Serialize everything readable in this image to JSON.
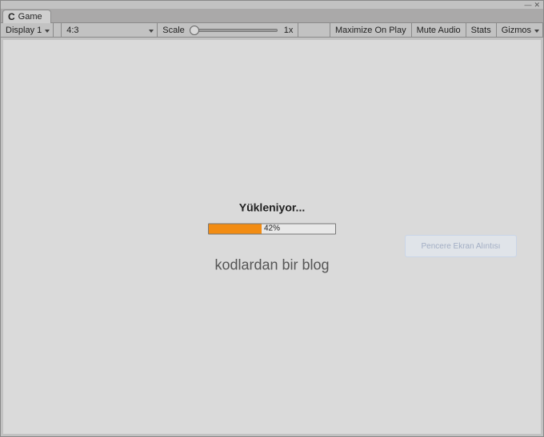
{
  "tab": {
    "label": "Game",
    "logo": "C"
  },
  "toolbar": {
    "display": "Display 1",
    "aspect": "4:3",
    "scale_label": "Scale",
    "scale_value": "1x",
    "maximize": "Maximize On Play",
    "mute": "Mute Audio",
    "stats": "Stats",
    "gizmos": "Gizmos"
  },
  "loading": {
    "title": "Yükleniyor...",
    "percent_text": "42%",
    "percent_value": 42
  },
  "subtitle": "kodlardan bir blog",
  "ghost": "Pencere Ekran Alıntısı",
  "window_controls": {
    "min": "—",
    "close": "✕"
  }
}
